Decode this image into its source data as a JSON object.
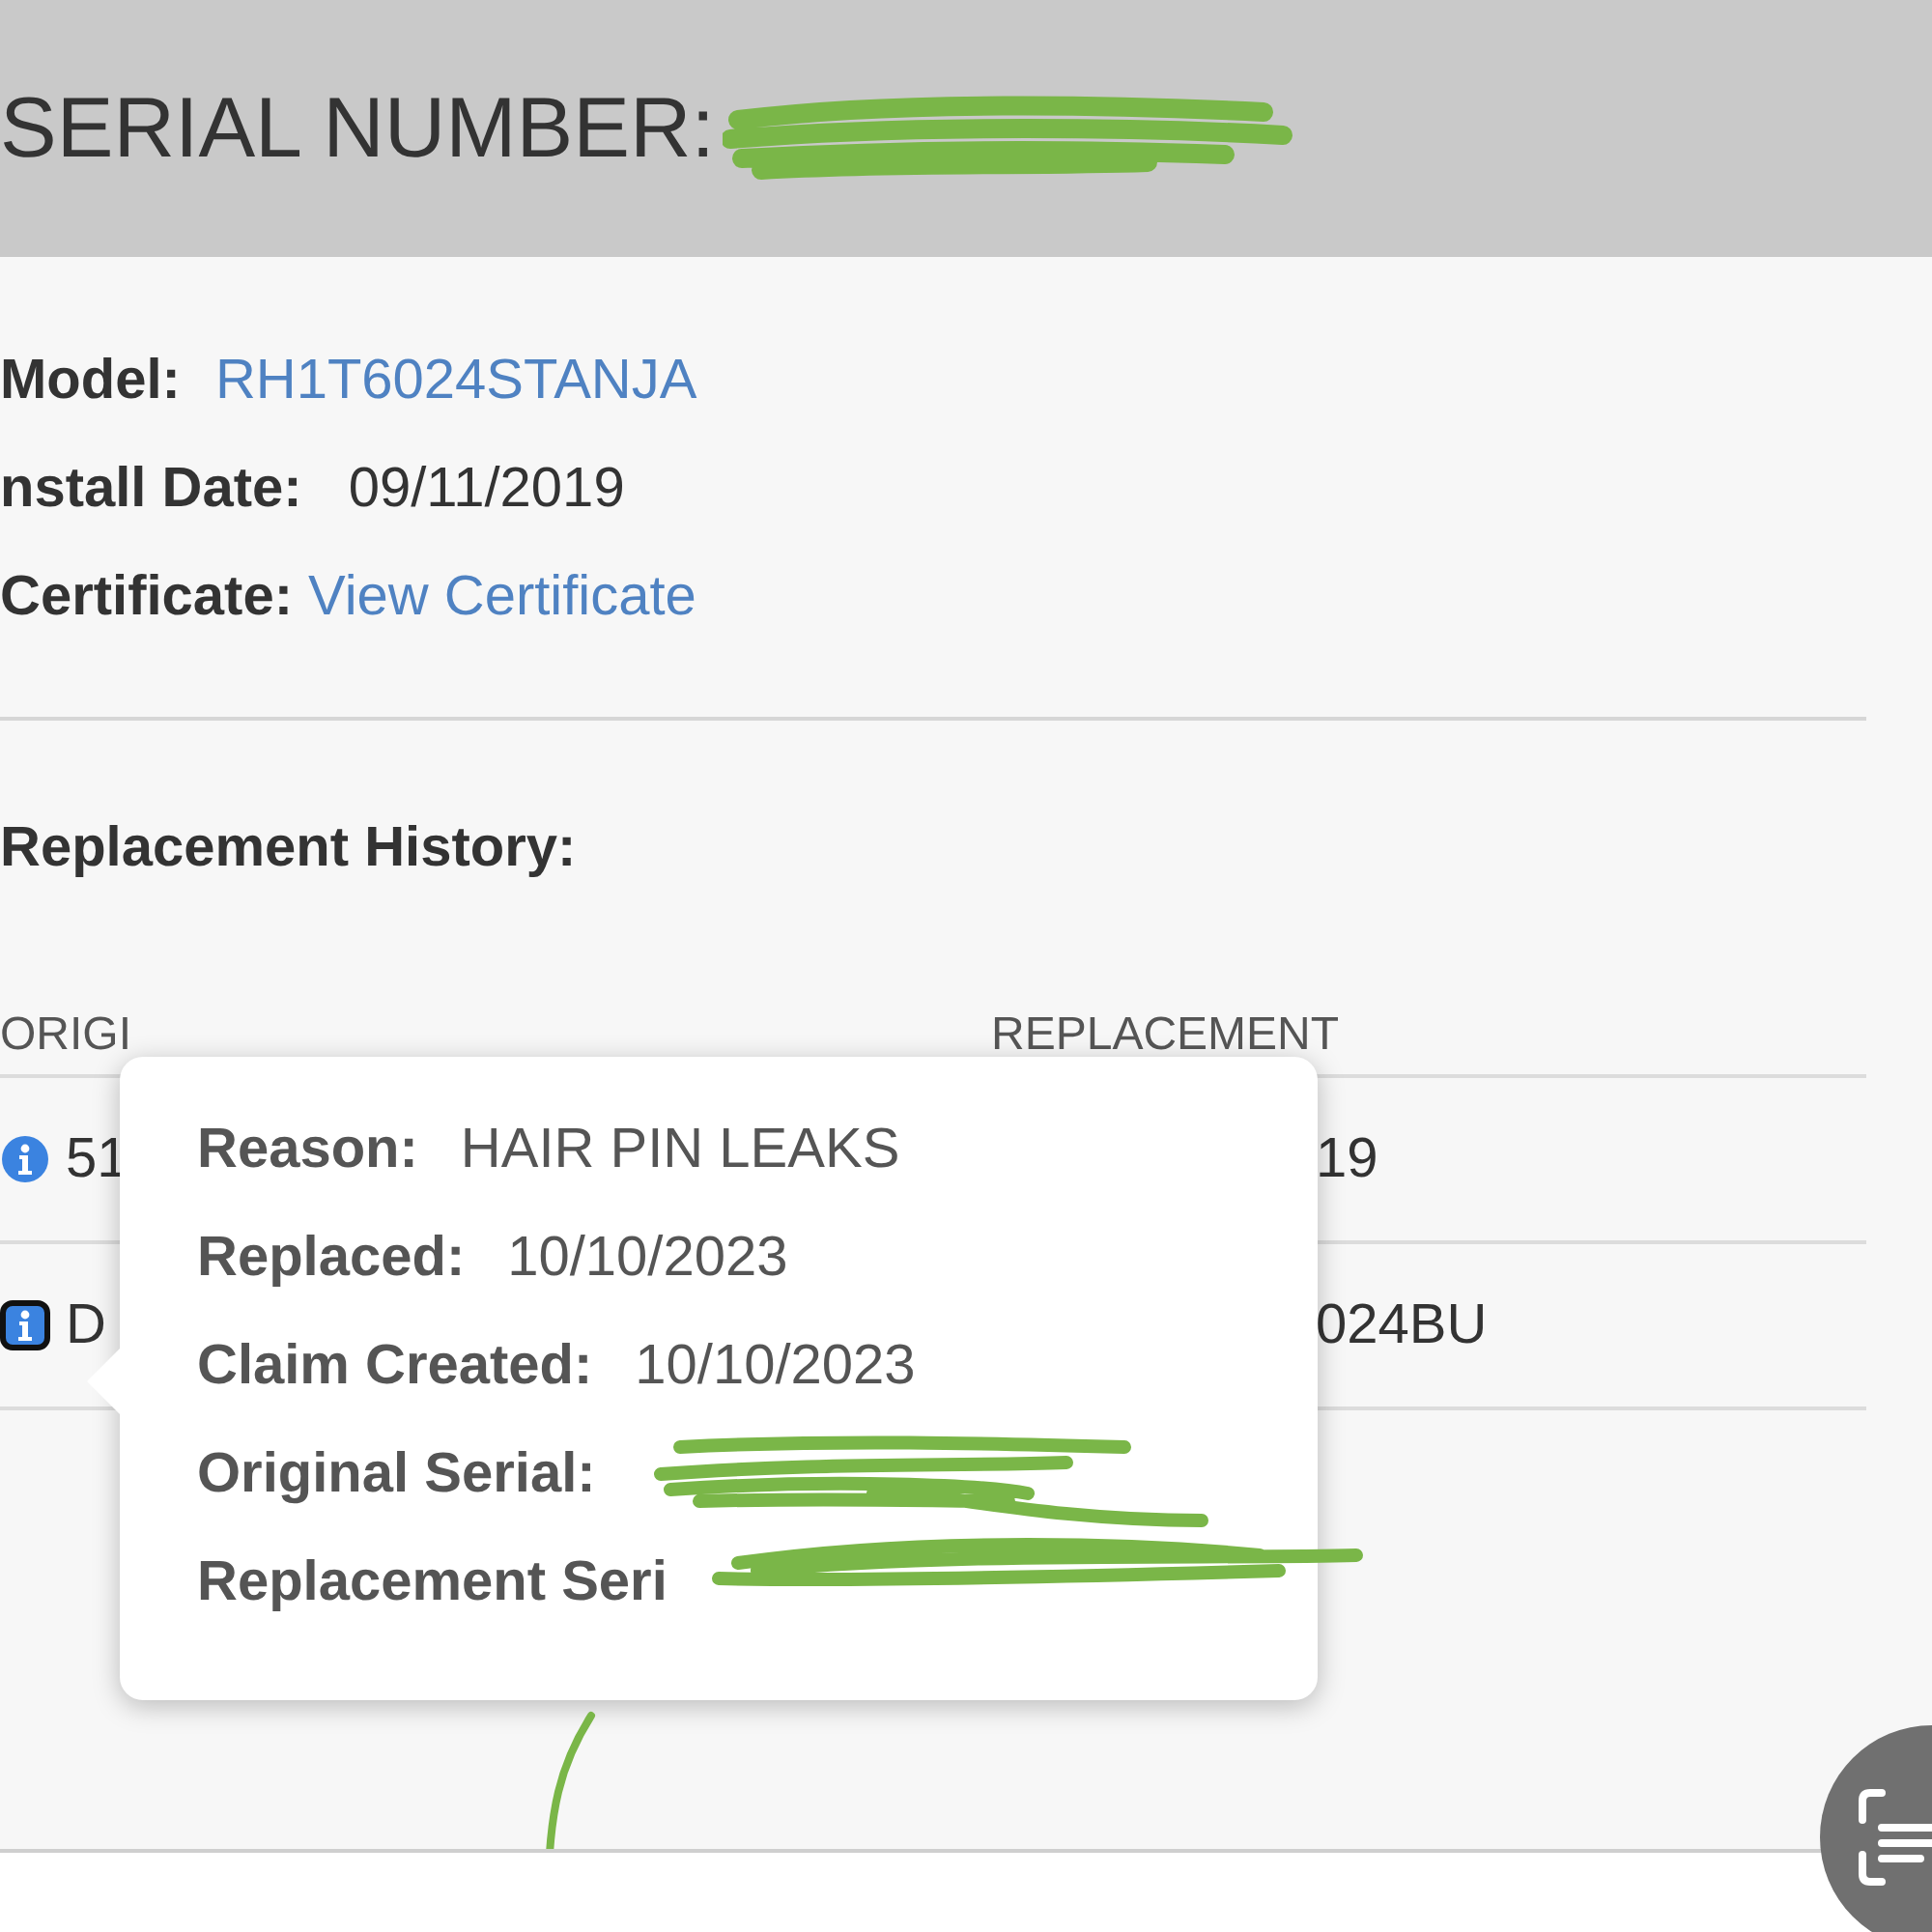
{
  "header": {
    "title": "SERIAL NUMBER:"
  },
  "details": [
    {
      "label": "Model:",
      "value": "RH1T6024STANJA",
      "kind": "link"
    },
    {
      "label": "nstall Date:",
      "value": "09/11/2019",
      "kind": "text"
    },
    {
      "label": "Certificate:",
      "value": "View Certificate",
      "kind": "link"
    }
  ],
  "history": {
    "title": "Replacement History:",
    "columns": [
      "ORIGI",
      "REPLACEMENT"
    ],
    "rows": [
      {
        "original": "51",
        "replacement": "19",
        "focused": false
      },
      {
        "original": "D",
        "replacement": "024BU",
        "focused": true
      }
    ]
  },
  "tooltip": {
    "items": [
      {
        "label": "Reason:",
        "value": "HAIR PIN LEAKS"
      },
      {
        "label": "Replaced:",
        "value": "10/10/2023"
      },
      {
        "label": "Claim Created:",
        "value": "10/10/2023"
      },
      {
        "label": "Original Serial:"
      },
      {
        "label": "Replacement Seri"
      }
    ]
  }
}
